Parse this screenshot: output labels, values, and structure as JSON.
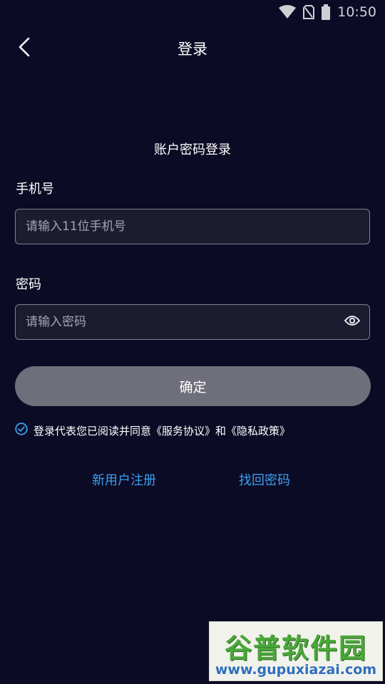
{
  "status_bar": {
    "time": "10:50",
    "icons": [
      "wifi-icon",
      "no-sim-icon",
      "battery-icon"
    ]
  },
  "header": {
    "title": "登录",
    "back_icon": "chevron-left-icon"
  },
  "login": {
    "subtitle": "账户密码登录",
    "phone": {
      "label": "手机号",
      "placeholder": "请输入11位手机号",
      "value": ""
    },
    "password": {
      "label": "密码",
      "placeholder": "请输入密码",
      "value": "",
      "toggle_icon": "eye-icon"
    },
    "submit_label": "确定",
    "agreement": {
      "checked": true,
      "text": "登录代表您已阅读并同意《服务协议》和《隐私政策》"
    },
    "links": {
      "register": "新用户注册",
      "forgot": "找回密码"
    }
  },
  "watermark": {
    "logo_text": "谷普软件园",
    "url": "www.gupuxiazai.com"
  },
  "colors": {
    "background": "#0c0b25",
    "input_bg": "#1c1c30",
    "input_border": "#7f8092",
    "button_bg": "#6e6f7a",
    "link": "#3b9ff0",
    "checkbox": "#3b9ff0"
  }
}
